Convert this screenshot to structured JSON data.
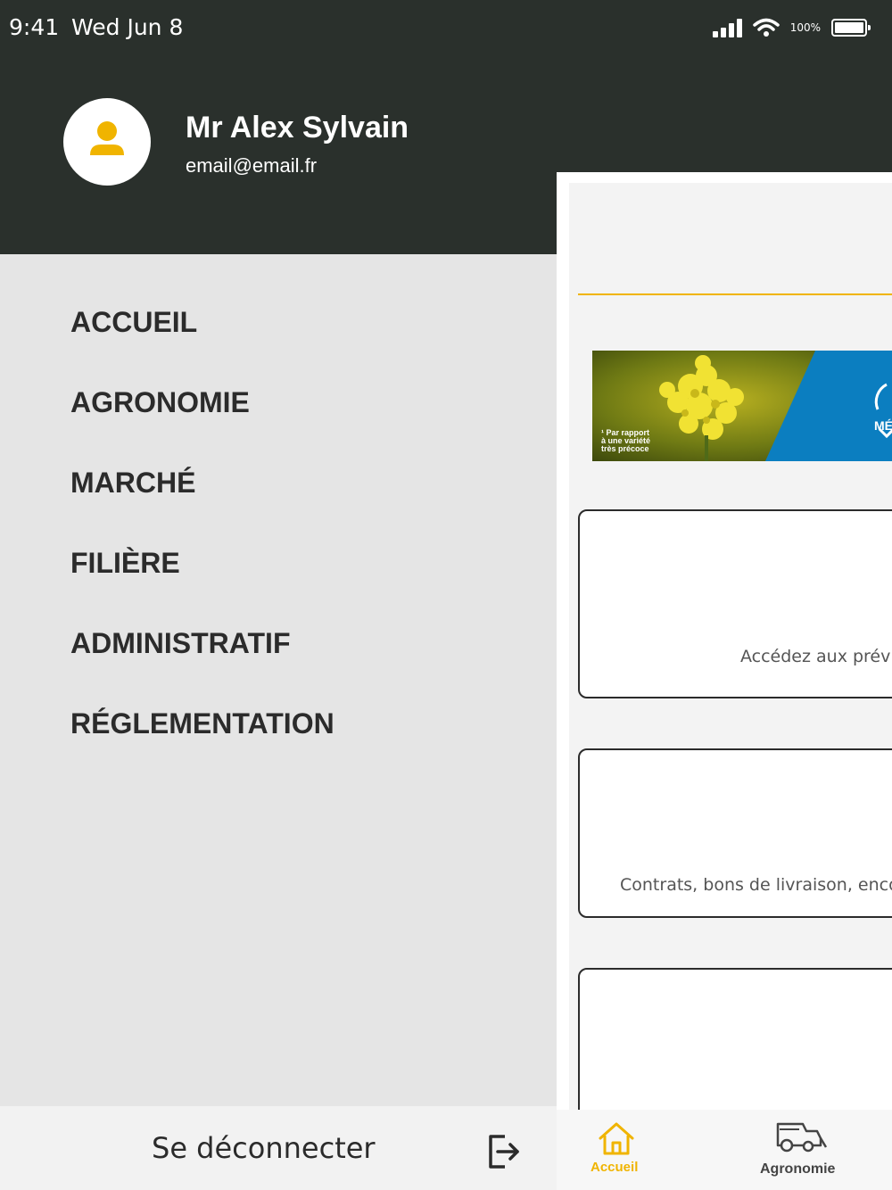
{
  "status_bar": {
    "time": "9:41",
    "date": "Wed Jun 8",
    "battery_percent": "100%",
    "signal_icon": "cellular-signal-icon",
    "wifi_icon": "wifi-icon",
    "battery_icon": "battery-icon"
  },
  "profile": {
    "name": "Mr Alex Sylvain",
    "email": "email@email.fr",
    "avatar_icon": "person-icon"
  },
  "menu": {
    "items": [
      {
        "label": "ACCUEIL"
      },
      {
        "label": "AGRONOMIE"
      },
      {
        "label": "MARCHÉ"
      },
      {
        "label": "FILIÈRE"
      },
      {
        "label": "ADMINISTRATIF"
      },
      {
        "label": "RÉGLEMENTATION"
      }
    ],
    "logout_label": "Se déconnecter",
    "logout_icon": "logout-arrow-icon"
  },
  "content": {
    "banner": {
      "footnote_lines": [
        "¹ Par rapport",
        "à une variété",
        "très précoce"
      ],
      "brand_partial": "MÉ"
    },
    "cards": [
      {
        "text": "Accédez aux prévis"
      },
      {
        "text": "Contrats, bons de livraison, encou"
      },
      {
        "text": ""
      }
    ]
  },
  "tabbar": {
    "tabs": [
      {
        "label": "Accueil",
        "icon": "home-icon",
        "active": true
      },
      {
        "label": "Agronomie",
        "icon": "harvester-icon",
        "active": false
      }
    ]
  },
  "colors": {
    "header_bg": "#2a302c",
    "drawer_bg": "#e5e5e5",
    "accent": "#f0b400",
    "text_dark": "#2b2b2b"
  }
}
